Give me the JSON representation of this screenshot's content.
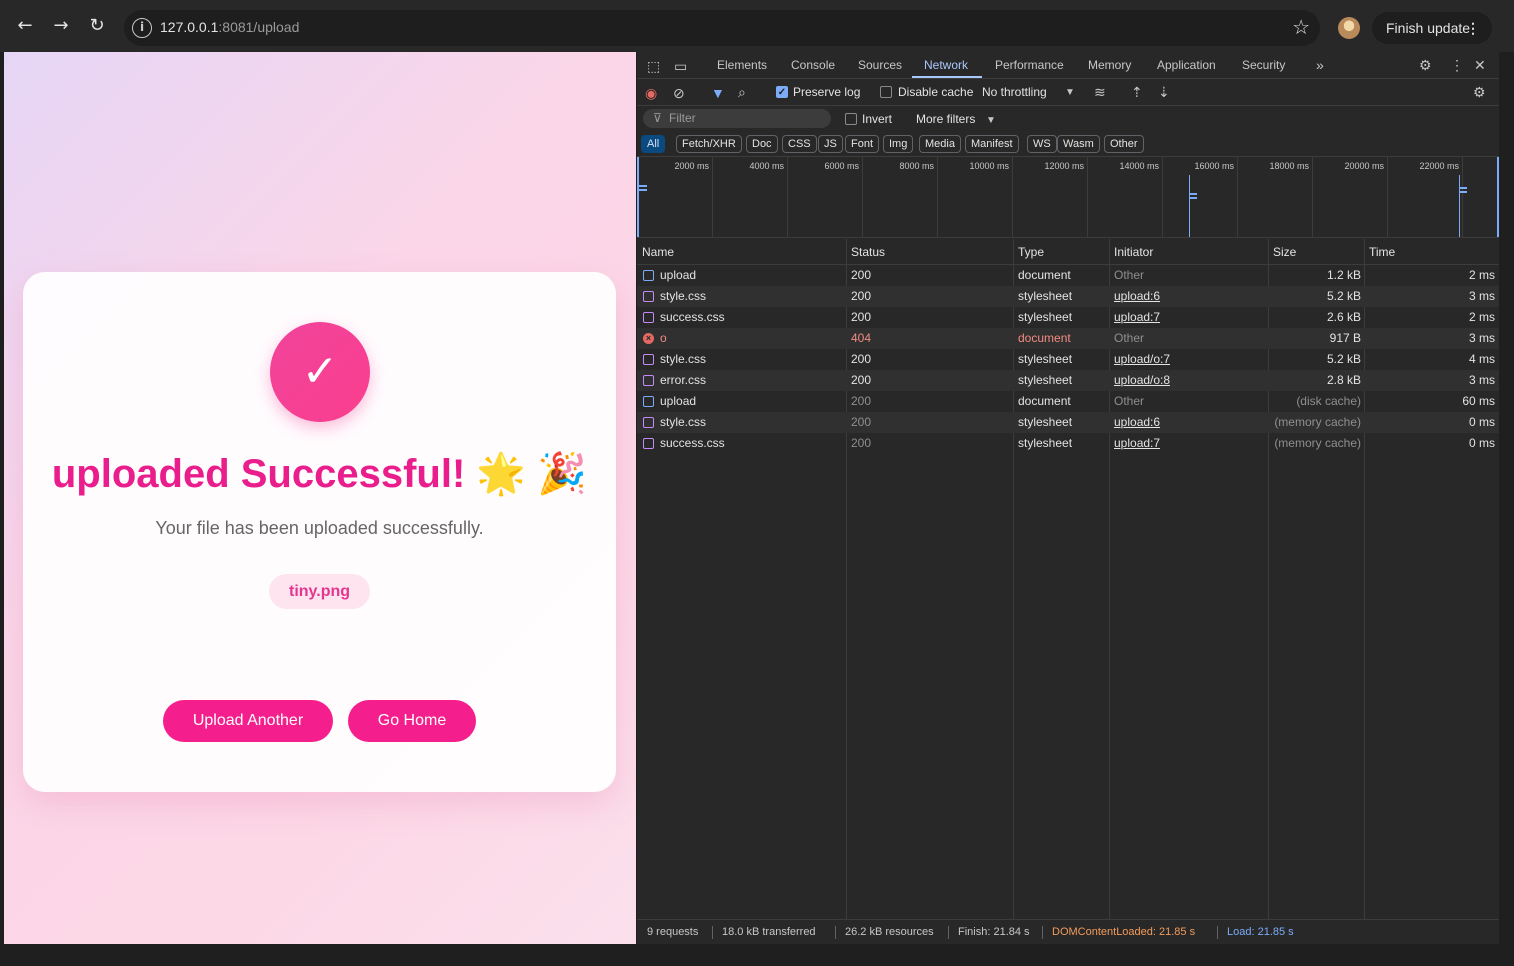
{
  "browser": {
    "url_host": "127.0.0.1",
    "url_rest": ":8081/upload",
    "finish_update_label": "Finish update"
  },
  "page": {
    "check_symbol": "✓",
    "title": "uploaded Successful! 🌟 🎉",
    "message": "Your file has been uploaded successfully.",
    "filename": "tiny.png",
    "upload_another_label": "Upload Another",
    "go_home_label": "Go Home",
    "accent_color": "#e91e8c"
  },
  "devtools": {
    "tabs": [
      "Elements",
      "Console",
      "Sources",
      "Network",
      "Performance",
      "Memory",
      "Application",
      "Security"
    ],
    "active_tab": "Network",
    "toolbar": {
      "preserve_log": "Preserve log",
      "disable_cache": "Disable cache",
      "throttling": "No throttling"
    },
    "filter": {
      "placeholder": "Filter",
      "invert": "Invert",
      "more_filters": "More filters"
    },
    "type_filters": [
      "All",
      "Fetch/XHR",
      "Doc",
      "CSS",
      "JS",
      "Font",
      "Img",
      "Media",
      "Manifest",
      "WS",
      "Wasm",
      "Other"
    ],
    "timeline_labels": [
      "2000 ms",
      "4000 ms",
      "6000 ms",
      "8000 ms",
      "10000 ms",
      "12000 ms",
      "14000 ms",
      "16000 ms",
      "18000 ms",
      "20000 ms",
      "22000 ms"
    ],
    "columns": [
      "Name",
      "Status",
      "Type",
      "Initiator",
      "Size",
      "Time"
    ],
    "requests": [
      {
        "name": "upload",
        "status": "200",
        "type": "document",
        "initiator": "Other",
        "size": "1.2 kB",
        "time": "2 ms",
        "kind": "doc"
      },
      {
        "name": "style.css",
        "status": "200",
        "type": "stylesheet",
        "initiator": "upload:6",
        "size": "5.2 kB",
        "time": "3 ms",
        "kind": "css"
      },
      {
        "name": "success.css",
        "status": "200",
        "type": "stylesheet",
        "initiator": "upload:7",
        "size": "2.6 kB",
        "time": "2 ms",
        "kind": "css"
      },
      {
        "name": "o",
        "status": "404",
        "type": "document",
        "initiator": "Other",
        "size": "917 B",
        "time": "3 ms",
        "kind": "err"
      },
      {
        "name": "style.css",
        "status": "200",
        "type": "stylesheet",
        "initiator": "upload/o:7",
        "size": "5.2 kB",
        "time": "4 ms",
        "kind": "css"
      },
      {
        "name": "error.css",
        "status": "200",
        "type": "stylesheet",
        "initiator": "upload/o:8",
        "size": "2.8 kB",
        "time": "3 ms",
        "kind": "css"
      },
      {
        "name": "upload",
        "status": "200",
        "type": "document",
        "initiator": "Other",
        "size": "(disk cache)",
        "time": "60 ms",
        "kind": "doc",
        "cached": true
      },
      {
        "name": "style.css",
        "status": "200",
        "type": "stylesheet",
        "initiator": "upload:6",
        "size": "(memory cache)",
        "time": "0 ms",
        "kind": "css",
        "cached": true
      },
      {
        "name": "success.css",
        "status": "200",
        "type": "stylesheet",
        "initiator": "upload:7",
        "size": "(memory cache)",
        "time": "0 ms",
        "kind": "css",
        "cached": true
      }
    ],
    "status_bar": {
      "requests": "9 requests",
      "transferred": "18.0 kB transferred",
      "resources": "26.2 kB resources",
      "finish": "Finish: 21.84 s",
      "dom_content_loaded": "DOMContentLoaded: 21.85 s",
      "load": "Load: 21.85 s"
    }
  }
}
